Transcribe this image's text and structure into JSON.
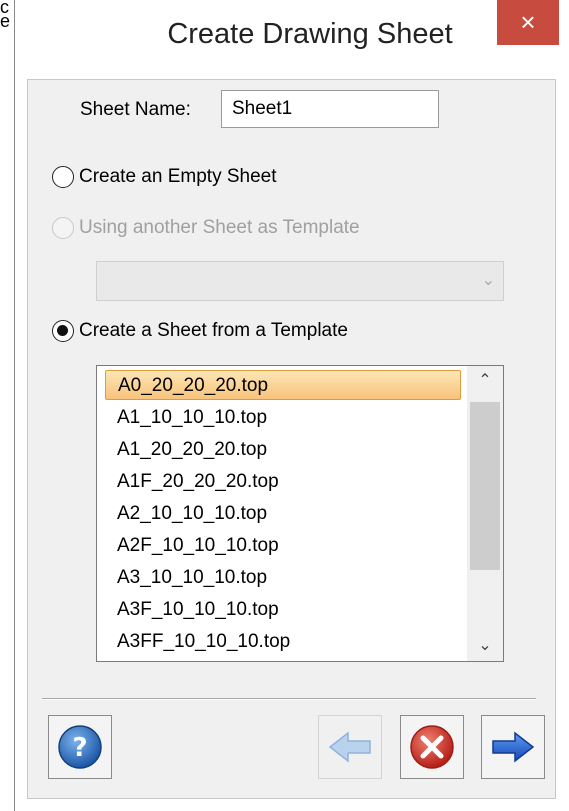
{
  "background_app": {
    "partial_text": "c\ne"
  },
  "dialog": {
    "title": "Create Drawing Sheet",
    "close_glyph": "×",
    "sheet_name_label": "Sheet Name:",
    "sheet_name_value": "Sheet1",
    "options": {
      "empty_sheet": "Create an Empty Sheet",
      "another_sheet_template": "Using another Sheet as Template",
      "from_template": "Create a Sheet from a Template"
    },
    "selected_option": "from_template",
    "template_sheet_combo_value": "",
    "templates": [
      "A0_20_20_20.top",
      "A1_10_10_10.top",
      "A1_20_20_20.top",
      "A1F_20_20_20.top",
      "A2_10_10_10.top",
      "A2F_10_10_10.top",
      "A3_10_10_10.top",
      "A3F_10_10_10.top",
      "A3FF_10_10_10.top"
    ],
    "selected_template": "A0_20_20_20.top",
    "buttons": {
      "help_icon": "help-icon",
      "back_icon": "arrow-left-icon",
      "cancel_icon": "cancel-icon",
      "next_icon": "arrow-right-icon"
    },
    "colors": {
      "close_button": "#c84b3f",
      "selection_top": "#fde6b6",
      "selection_bottom": "#f8c37a",
      "help_blue": "#2d6fb8",
      "cancel_red": "#d43a2f",
      "next_blue": "#1f66d1"
    }
  }
}
